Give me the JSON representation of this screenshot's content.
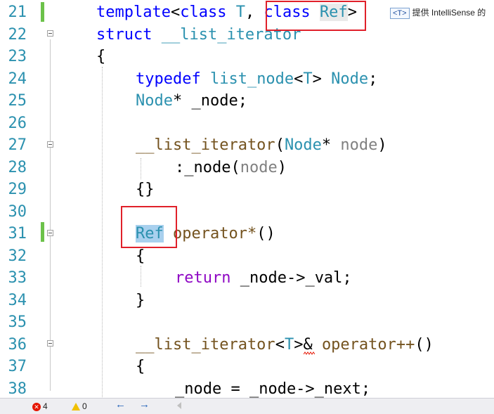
{
  "line_numbers": [
    "21",
    "22",
    "23",
    "24",
    "25",
    "26",
    "27",
    "28",
    "29",
    "30",
    "31",
    "32",
    "33",
    "34",
    "35",
    "36",
    "37",
    "38"
  ],
  "code": {
    "l21": {
      "template": "template",
      "lt": "<",
      "class1": "class",
      "T": " T",
      "comma": ", ",
      "class2": "class",
      "Ref": "Ref",
      "gt": ">"
    },
    "l22": {
      "struct": "struct",
      "name": " __list_iterator"
    },
    "l23": {
      "brace": "{"
    },
    "l24": {
      "typedef": "typedef",
      "list_node": " list_node",
      "lt": "<",
      "T": "T",
      "gt": ">",
      "Node": " Node",
      "semi": ";"
    },
    "l25": {
      "Node": "Node",
      "rest": "* _node;"
    },
    "l27": {
      "fn": "__list_iterator",
      "open": "(",
      "Node": "Node",
      "star": "* ",
      "param": "node",
      "close": ")"
    },
    "l28": {
      "init": ":_node(",
      "param": "node",
      "close": ")"
    },
    "l29": {
      "braces": "{}"
    },
    "l31": {
      "Ref": "Ref",
      "op": " operator*",
      "parens": "()"
    },
    "l32": {
      "brace": "{"
    },
    "l33": {
      "ret": "return",
      "rest": " _node->_val;"
    },
    "l34": {
      "brace": "}"
    },
    "l36": {
      "fn": "__list_iterator",
      "lt": "<",
      "T": "T",
      "gt": ">",
      "amp": "& ",
      "op": "operator++",
      "parens": "()"
    },
    "l37": {
      "brace": "{"
    },
    "l38": {
      "rest": "_node = _node->_next;"
    }
  },
  "tooltip": {
    "tag": "<T>",
    "text": "提供 IntelliSense 的"
  },
  "status": {
    "errors": "4",
    "warnings": "0",
    "back": "←",
    "forward": "→"
  },
  "colors": {
    "keyword": "#0000ff",
    "type": "#2b91af",
    "function": "#74531f",
    "param": "#808080",
    "control": "#8f08c4",
    "highlight_box": "#e0202a",
    "change_bar": "#6cc24a"
  }
}
